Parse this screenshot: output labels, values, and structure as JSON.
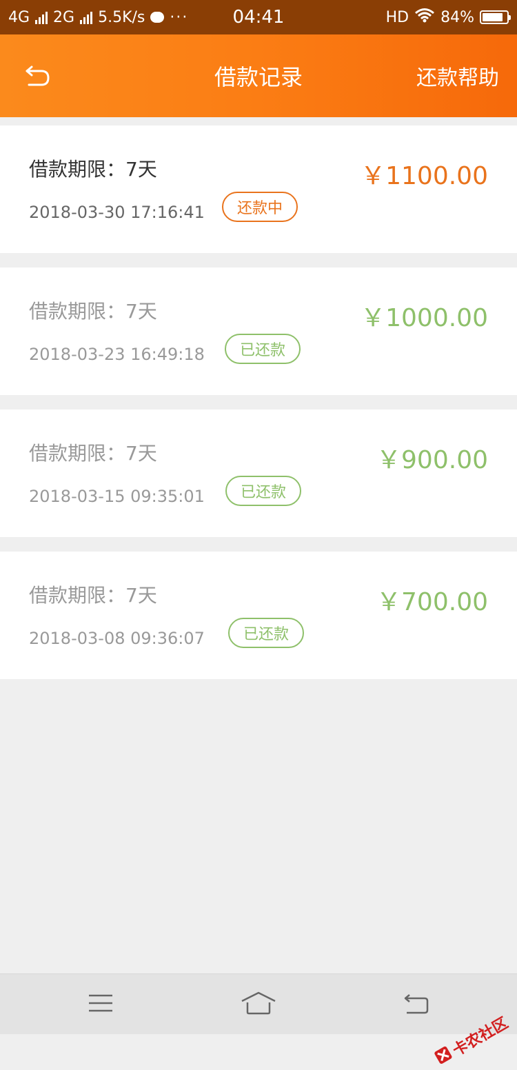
{
  "status_bar": {
    "network_1": "4G",
    "network_2": "2G",
    "speed": "5.5K/s",
    "more": "···",
    "time": "04:41",
    "hd": "HD",
    "battery": "84%",
    "battery_level": 0.84
  },
  "header": {
    "title": "借款记录",
    "help_label": "还款帮助"
  },
  "records": [
    {
      "term": "借款期限：7天",
      "date": "2018-03-30 17:16:41",
      "status": "还款中",
      "amount": "￥1100.00"
    },
    {
      "term": "借款期限：7天",
      "date": "2018-03-23 16:49:18",
      "status": "已还款",
      "amount": "￥1000.00"
    },
    {
      "term": "借款期限：7天",
      "date": "2018-03-15 09:35:01",
      "status": "已还款",
      "amount": "￥900.00"
    },
    {
      "term": "借款期限：7天",
      "date": "2018-03-08 09:36:07",
      "status": "已还款",
      "amount": "￥700.00"
    }
  ],
  "watermark": {
    "text": "卡农社区"
  },
  "colors": {
    "accent": "#fb7d14",
    "active_status": "#e9731c",
    "repaid_status": "#8ec06a"
  },
  "icons": {
    "back": "back-arrow-icon",
    "menu": "menu-icon",
    "home": "home-icon",
    "system_back": "system-back-icon"
  }
}
